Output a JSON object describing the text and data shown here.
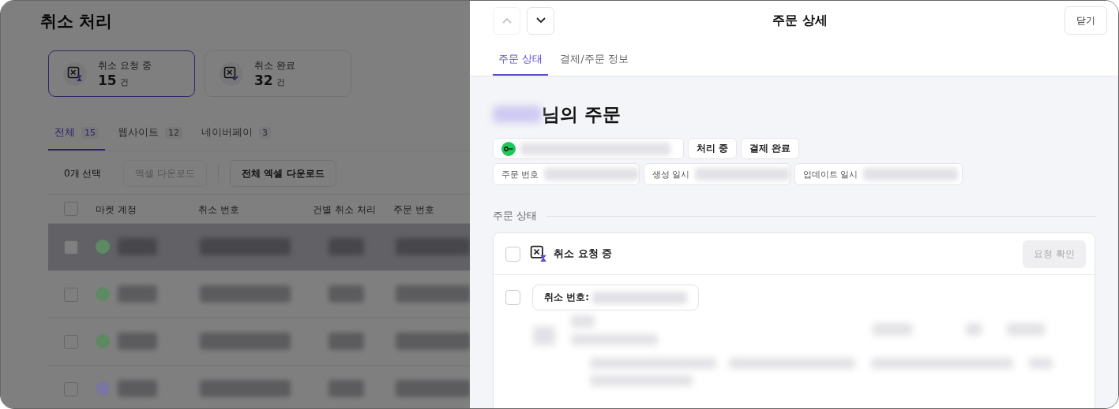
{
  "page": {
    "title": "취소 처리",
    "summary_cards": [
      {
        "kind": "pending",
        "label": "취소 요청 중",
        "count": "15",
        "unit": "건",
        "selected": true
      },
      {
        "kind": "done",
        "label": "취소 완료",
        "count": "32",
        "unit": "건",
        "selected": false
      }
    ],
    "tabs": [
      {
        "label": "전체",
        "count": "15",
        "selected": true
      },
      {
        "label": "웹사이트",
        "count": "12",
        "selected": false
      },
      {
        "label": "네이버페이",
        "count": "3",
        "selected": false
      }
    ],
    "toolbar": {
      "selection": "0개 선택",
      "buttons": [
        {
          "label": "엑셀 다운로드",
          "disabled": true
        },
        {
          "label": "전체 엑셀 다운로드",
          "disabled": false
        }
      ]
    },
    "table": {
      "columns": [
        "마켓 계정",
        "취소 번호",
        "건별 취소 처리",
        "주문 번호"
      ],
      "header_checked": false,
      "rows": [
        {
          "checked": false,
          "selected": true,
          "color": "#5e8a63"
        },
        {
          "checked": false,
          "selected": false,
          "color": "#5e8a63"
        },
        {
          "checked": false,
          "selected": false,
          "color": "#5e8a63"
        },
        {
          "checked": false,
          "selected": false,
          "color": "#7a76a0"
        }
      ]
    }
  },
  "drawer": {
    "title": "주문 상세",
    "nav_buttons": [
      {
        "kind": "up",
        "disabled": true
      },
      {
        "kind": "down",
        "disabled": false
      }
    ],
    "close_button": "닫기",
    "tabs": [
      {
        "label": "주문 상태",
        "selected": true
      },
      {
        "label": "결제/주문 정보",
        "selected": false
      }
    ],
    "heading": "님의 주문",
    "status_chips": [
      "처리 중",
      "결제 완료"
    ],
    "info_fields": [
      {
        "label": "주문 번호"
      },
      {
        "label": "생성 일시"
      },
      {
        "label": "업데이트 일시"
      }
    ],
    "section_title": "주문 상태",
    "status_group": {
      "label": "취소 요청 중",
      "checked": false,
      "action": {
        "label": "요청 확인",
        "disabled": true
      },
      "items": [
        {
          "checked": false,
          "label": "취소 번호:"
        }
      ]
    }
  }
}
